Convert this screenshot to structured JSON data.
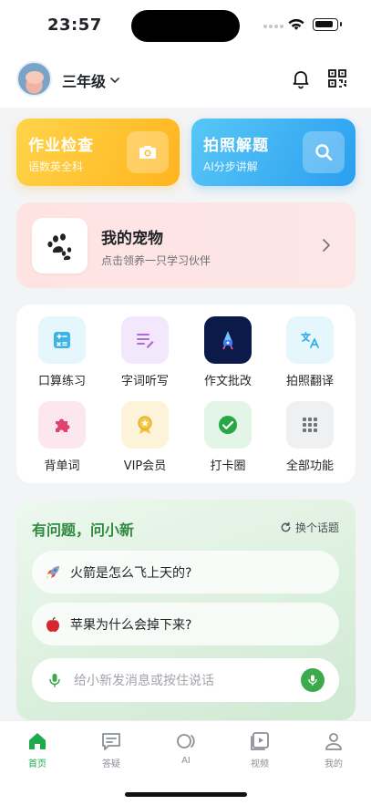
{
  "status_bar": {
    "time": "23:57"
  },
  "header": {
    "grade": "三年级"
  },
  "cards": {
    "homework": {
      "title": "作业检查",
      "subtitle": "语数英全科"
    },
    "photo": {
      "title": "拍照解题",
      "subtitle": "AI分步讲解"
    }
  },
  "pet": {
    "title": "我的宠物",
    "subtitle": "点击领养一只学习伙伴"
  },
  "features": [
    {
      "label": "口算练习",
      "icon": "calculator-icon",
      "bg": "#e6f6fd",
      "fg": "#3db3e8"
    },
    {
      "label": "字词听写",
      "icon": "pencil-list-icon",
      "bg": "#f3e8fb",
      "fg": "#b06bd6"
    },
    {
      "label": "作文批改",
      "icon": "essay-rocket-icon",
      "bg": "#0c1a4a",
      "fg": "#ffffff"
    },
    {
      "label": "拍照翻译",
      "icon": "translate-icon",
      "bg": "#e6f6fd",
      "fg": "#36b0e6"
    },
    {
      "label": "背单词",
      "icon": "puzzle-icon",
      "bg": "#fde7ee",
      "fg": "#e2426e"
    },
    {
      "label": "VIP会员",
      "icon": "vip-medal-icon",
      "bg": "#fdf3d8",
      "fg": "#e7b32a"
    },
    {
      "label": "打卡圈",
      "icon": "check-circle-icon",
      "bg": "#e3f5e7",
      "fg": "#28a745"
    },
    {
      "label": "全部功能",
      "icon": "grid-dots-icon",
      "bg": "#eef0f2",
      "fg": "#6e757c"
    }
  ],
  "ask": {
    "title": "有问题，问小新",
    "swap_label": "换个话题",
    "questions": [
      {
        "text": "火箭是怎么飞上天的?",
        "icon": "rocket-icon"
      },
      {
        "text": "苹果为什么会掉下来?",
        "icon": "apple-icon"
      }
    ],
    "input_placeholder": "给小新发消息或按住说话"
  },
  "tabs": [
    {
      "label": "首页",
      "icon": "home-icon",
      "active": true
    },
    {
      "label": "答疑",
      "icon": "chat-icon",
      "active": false
    },
    {
      "label": "AI",
      "icon": "ai-icon",
      "active": false
    },
    {
      "label": "视频",
      "icon": "video-icon",
      "active": false
    },
    {
      "label": "我的",
      "icon": "profile-icon",
      "active": false
    }
  ]
}
